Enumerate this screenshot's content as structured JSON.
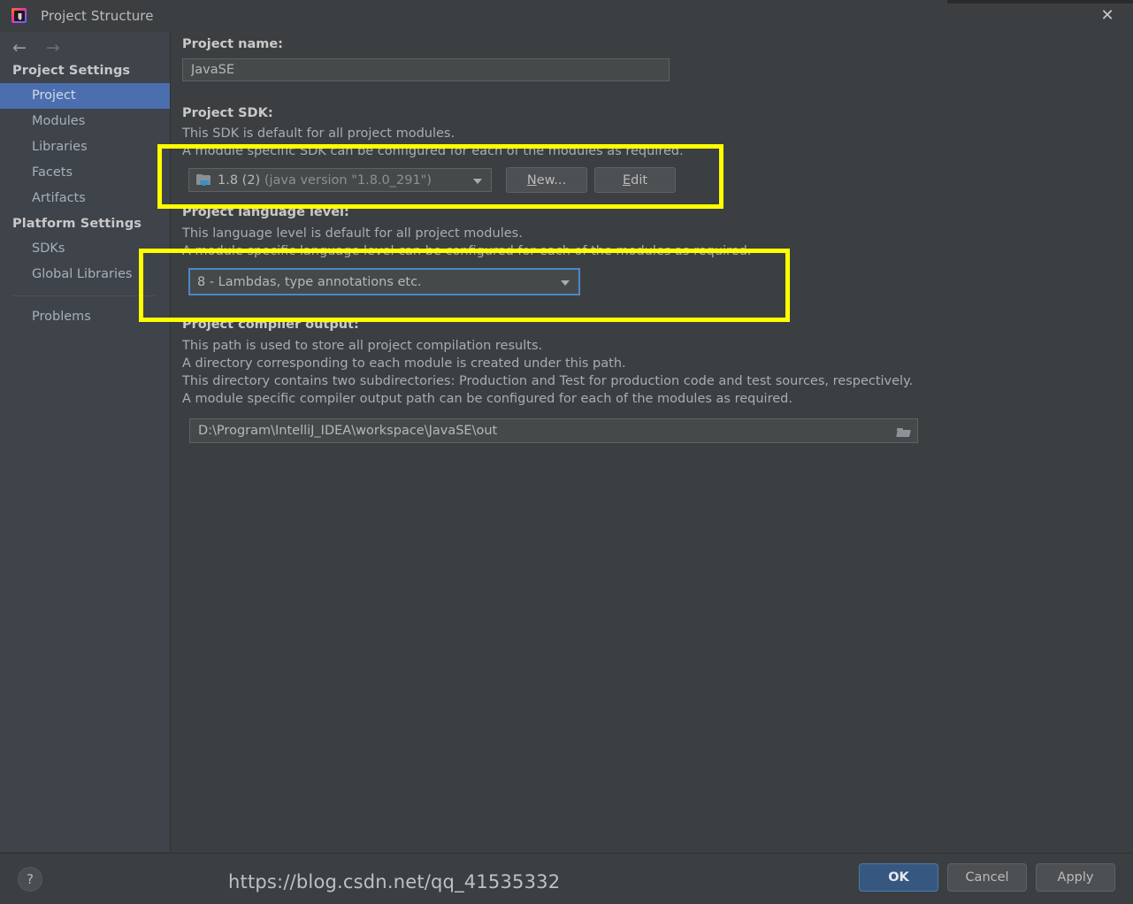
{
  "window": {
    "title": "Project Structure",
    "app_icon": "intellij-idea-icon",
    "close_icon": "✕"
  },
  "nav": {
    "back_icon": "←",
    "forward_icon": "→"
  },
  "sidebar": {
    "groups": [
      {
        "header": "Project Settings",
        "items": [
          {
            "label": "Project",
            "selected": true
          },
          {
            "label": "Modules",
            "selected": false
          },
          {
            "label": "Libraries",
            "selected": false
          },
          {
            "label": "Facets",
            "selected": false
          },
          {
            "label": "Artifacts",
            "selected": false
          }
        ]
      },
      {
        "header": "Platform Settings",
        "items": [
          {
            "label": "SDKs",
            "selected": false
          },
          {
            "label": "Global Libraries",
            "selected": false
          }
        ]
      }
    ],
    "problems_label": "Problems"
  },
  "main": {
    "project_name": {
      "label": "Project name:",
      "value": "JavaSE"
    },
    "project_sdk": {
      "label": "Project SDK:",
      "desc_line1": "This SDK is default for all project modules.",
      "desc_line2": "A module specific SDK can be configured for each of the modules as required.",
      "selected_name": "1.8 (2)",
      "selected_version": "(java version \"1.8.0_291\")",
      "icon": "java-sdk-folder-icon",
      "new_button": "New...",
      "edit_button": "Edit"
    },
    "language_level": {
      "label": "Project language level:",
      "desc_line1": "This language level is default for all project modules.",
      "desc_line2": "A module specific language level can be configured for each of the modules as required.",
      "selected": "8 - Lambdas, type annotations etc."
    },
    "compiler_output": {
      "label": "Project compiler output:",
      "desc_line1": "This path is used to store all project compilation results.",
      "desc_line2": "A directory corresponding to each module is created under this path.",
      "desc_line3": "This directory contains two subdirectories: Production and Test for production code and test sources, respectively.",
      "desc_line4": "A module specific compiler output path can be configured for each of the modules as required.",
      "path": "D:\\Program\\IntelliJ_IDEA\\workspace\\JavaSE\\out",
      "browse_icon": "folder-open-icon"
    }
  },
  "footer": {
    "help_label": "?",
    "ok_label": "OK",
    "cancel_label": "Cancel",
    "apply_label": "Apply"
  },
  "watermark": {
    "text": "https://blog.csdn.net/qq_41535332"
  },
  "colors": {
    "background": "#3c3f41",
    "sidebar": "#3f434a",
    "selection": "#4b6eaf",
    "primary_button": "#365880",
    "highlight": "#ffff00",
    "field_bg": "#45494a",
    "focus_border": "#4a88c7"
  }
}
